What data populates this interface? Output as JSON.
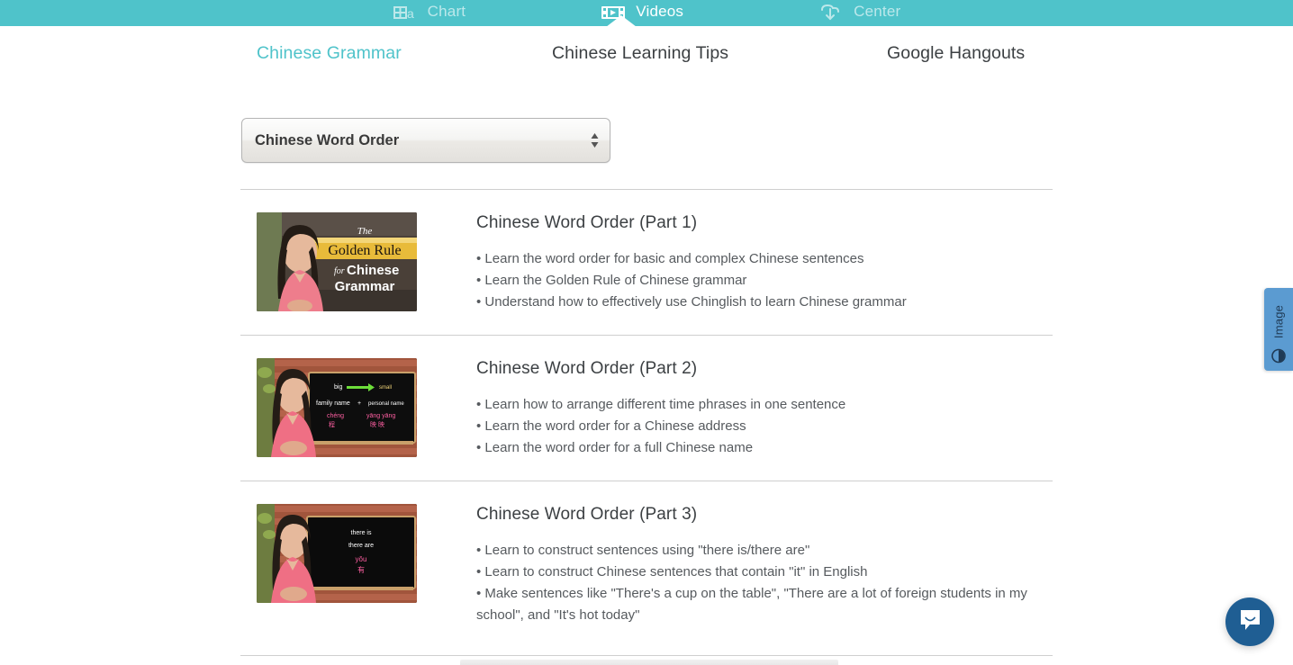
{
  "top_nav": {
    "background_color": "#4fc3ca",
    "active_index": 1,
    "items": [
      {
        "label": "Chart",
        "icon": "table-chart-icon",
        "state": "inactive"
      },
      {
        "label": "Videos",
        "icon": "film-strip-play-icon",
        "state": "active"
      },
      {
        "label": "Center",
        "icon": "cloud-download-icon",
        "state": "inactive"
      }
    ]
  },
  "subtabs": {
    "active_color": "#4fc3ca",
    "inactive_color": "#3c4043",
    "items": [
      {
        "label": "Chinese Grammar",
        "state": "active"
      },
      {
        "label": "Chinese Learning Tips",
        "state": "inactive"
      },
      {
        "label": "Google Hangouts",
        "state": "inactive"
      }
    ]
  },
  "series_select": {
    "selected": "Chinese Word Order",
    "options": [
      "Chinese Word Order"
    ]
  },
  "videos": [
    {
      "title": "Chinese Word Order (Part 1)",
      "bullets": [
        "• Learn the word order for basic and complex Chinese sentences",
        "• Learn the Golden Rule of Chinese grammar",
        "• Understand how to effectively use Chinglish to learn Chinese grammar"
      ],
      "thumbnail": {
        "name": "video-thumbnail-golden-rule",
        "overlay_lines": [
          "The",
          "Golden Rule",
          "for Chinese",
          "Grammar"
        ],
        "accent_color": "#e8bb3a"
      }
    },
    {
      "title": "Chinese Word Order (Part 2)",
      "bullets": [
        "• Learn how to arrange different time phrases in one sentence",
        "• Learn the word order for a Chinese address",
        "• Learn the word order for a full Chinese name"
      ],
      "thumbnail": {
        "name": "video-thumbnail-name-order",
        "board_lines": [
          "big",
          "small",
          "family name",
          "+",
          "personal name",
          "chéng",
          "程",
          "yāng yāng",
          "映 映"
        ],
        "accent_color": "#6ddd3a"
      }
    },
    {
      "title": "Chinese Word Order (Part 3)",
      "bullets": [
        "• Learn to construct sentences using \"there is/there are\"",
        "• Learn to construct Chinese sentences that contain \"it\" in English",
        "• Make sentences like \"There's a cup on the table\", \"There are a lot of foreign students in my school\", and \"It's hot today\""
      ],
      "thumbnail": {
        "name": "video-thumbnail-there-is",
        "board_lines": [
          "there is",
          "there are",
          "yǒu",
          "有"
        ],
        "accent_color": "#ff5fa2"
      }
    }
  ],
  "image_tab": {
    "label": "Image",
    "icon": "contrast-circle-icon",
    "background_color": "#5b9bd1"
  },
  "chat_launcher": {
    "icon": "chat-smile-bubble-icon",
    "background_color": "#1f5e93"
  }
}
